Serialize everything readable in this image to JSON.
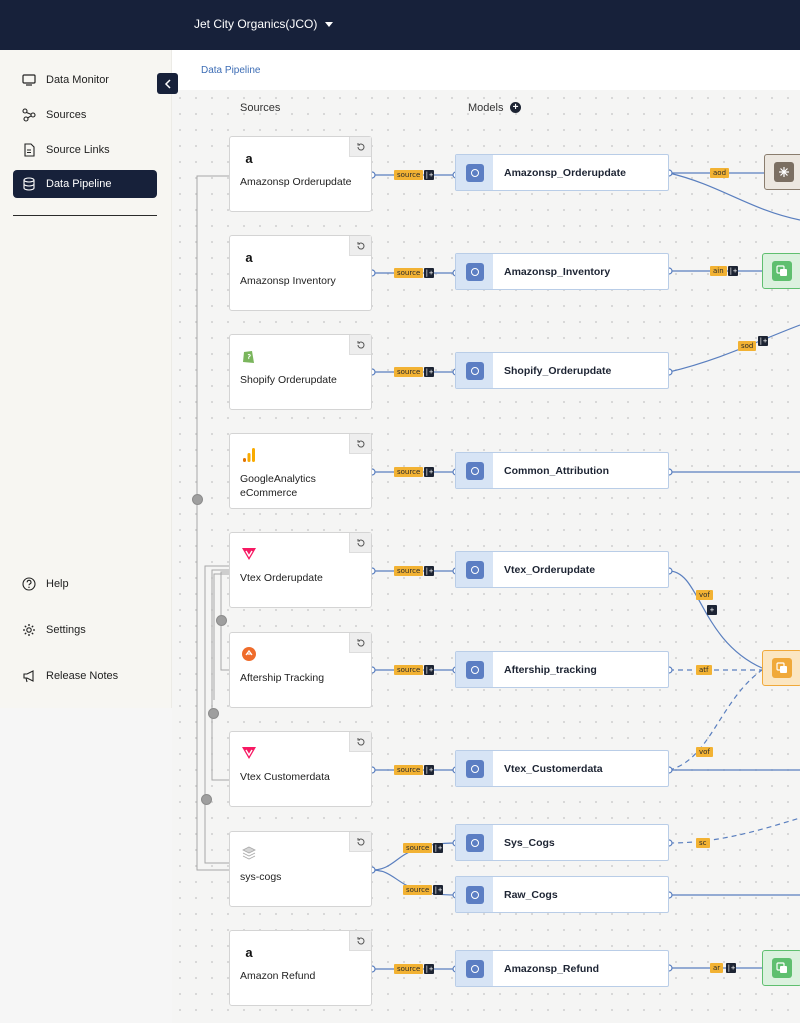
{
  "app": {
    "org_selector": "Jet City Organics(JCO)",
    "breadcrumb": "Data Pipeline"
  },
  "sidebar": {
    "top_items": [
      {
        "label": "Data Monitor",
        "icon": "monitor-icon",
        "active": false
      },
      {
        "label": "Sources",
        "icon": "nodes-icon",
        "active": false
      },
      {
        "label": "Source Links",
        "icon": "file-link-icon",
        "active": false
      },
      {
        "label": "Data Pipeline",
        "icon": "database-icon",
        "active": true
      }
    ],
    "bottom_items": [
      {
        "label": "Help",
        "icon": "question-icon"
      },
      {
        "label": "Settings",
        "icon": "gear-icon"
      },
      {
        "label": "Release Notes",
        "icon": "megaphone-icon"
      }
    ]
  },
  "canvas": {
    "sources_label": "Sources",
    "models_label": "Models",
    "source_tag": "source"
  },
  "sources": [
    {
      "label": "Amazonsp Orderupdate",
      "logo": "amazon-logo-icon",
      "logo_text": "a"
    },
    {
      "label": "Amazonsp Inventory",
      "logo": "amazon-logo-icon",
      "logo_text": "a"
    },
    {
      "label": "Shopify Orderupdate",
      "logo": "shopify-logo-icon",
      "logo_text": ""
    },
    {
      "label": "GoogleAnalytics eCommerce",
      "logo": "google-analytics-logo-icon",
      "logo_text": ""
    },
    {
      "label": "Vtex Orderupdate",
      "logo": "vtex-logo-icon",
      "logo_text": ""
    },
    {
      "label": "Aftership Tracking",
      "logo": "aftership-logo-icon",
      "logo_text": ""
    },
    {
      "label": "Vtex Customerdata",
      "logo": "vtex-logo-icon",
      "logo_text": ""
    },
    {
      "label": "sys-cogs",
      "logo": "layers-logo-icon",
      "logo_text": ""
    },
    {
      "label": "Amazon Refund",
      "logo": "amazon-logo-icon",
      "logo_text": "a"
    }
  ],
  "models": [
    {
      "label": "Amazonsp_Orderupdate"
    },
    {
      "label": "Amazonsp_Inventory"
    },
    {
      "label": "Shopify_Orderupdate"
    },
    {
      "label": "Common_Attribution"
    },
    {
      "label": "Vtex_Orderupdate"
    },
    {
      "label": "Aftership_tracking"
    },
    {
      "label": "Vtex_Customerdata"
    },
    {
      "label": "Sys_Cogs"
    },
    {
      "label": "Raw_Cogs"
    },
    {
      "label": "Amazonsp_Refund"
    }
  ],
  "edge_tags": {
    "aod": "aod",
    "ain": "ain",
    "sod": "sod",
    "vof_1": "vof",
    "atf": "atf",
    "vof_2": "vof",
    "sc": "sc",
    "ar": "ar"
  },
  "colors": {
    "topbar": "#17213a",
    "tag": "#f2b233",
    "model_accent": "#5c7ec3",
    "green_node": "#5fbf6f",
    "orange_node": "#f0a93a"
  }
}
